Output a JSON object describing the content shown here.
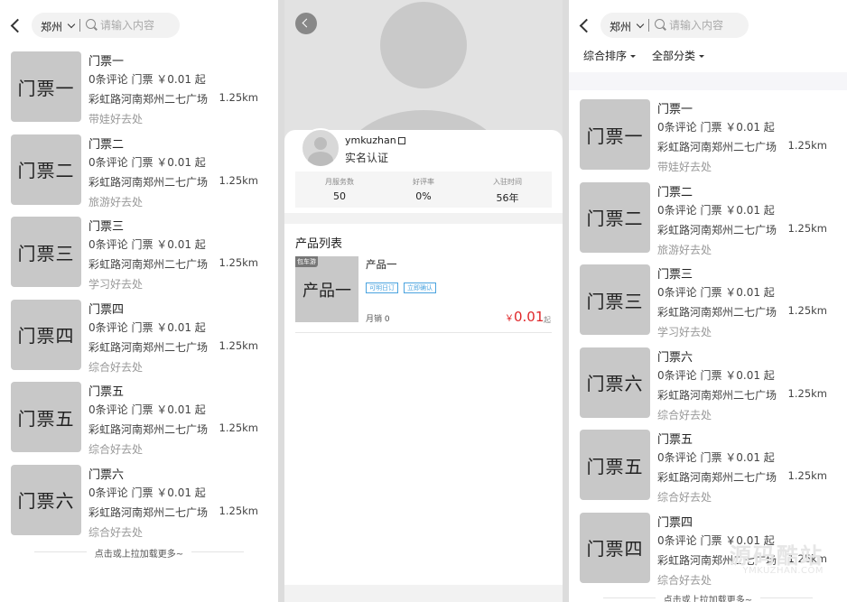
{
  "search": {
    "city": "郑州",
    "placeholder": "请输入内容"
  },
  "panel1": {
    "items": [
      {
        "thumb": "门票一",
        "name": "门票一",
        "meta": "0条评论  门票  ￥0.01  起",
        "addr": "彩虹路河南郑州二七广场",
        "dist": "1.25km",
        "tag": "带娃好去处"
      },
      {
        "thumb": "门票二",
        "name": "门票二",
        "meta": "0条评论  门票  ￥0.01  起",
        "addr": "彩虹路河南郑州二七广场",
        "dist": "1.25km",
        "tag": "旅游好去处"
      },
      {
        "thumb": "门票三",
        "name": "门票三",
        "meta": "0条评论  门票  ￥0.01  起",
        "addr": "彩虹路河南郑州二七广场",
        "dist": "1.25km",
        "tag": "学习好去处"
      },
      {
        "thumb": "门票四",
        "name": "门票四",
        "meta": "0条评论  门票  ￥0.01  起",
        "addr": "彩虹路河南郑州二七广场",
        "dist": "1.25km",
        "tag": "综合好去处"
      },
      {
        "thumb": "门票五",
        "name": "门票五",
        "meta": "0条评论  门票  ￥0.01  起",
        "addr": "彩虹路河南郑州二七广场",
        "dist": "1.25km",
        "tag": "综合好去处"
      },
      {
        "thumb": "门票六",
        "name": "门票六",
        "meta": "0条评论  门票  ￥0.01  起",
        "addr": "彩虹路河南郑州二七广场",
        "dist": "1.25km",
        "tag": "综合好去处"
      }
    ],
    "load_more": "点击或上拉加载更多~"
  },
  "panel2": {
    "username": "ymkuzhan",
    "verify": "实名认证",
    "stats": [
      {
        "label": "月服务数",
        "value": "50"
      },
      {
        "label": "好评率",
        "value": "0%"
      },
      {
        "label": "入驻时间",
        "value": "56年"
      }
    ],
    "section_title": "产品列表",
    "product": {
      "badge": "包车游",
      "thumb": "产品一",
      "name": "产品一",
      "chips": [
        "可明日订",
        "立即确认"
      ],
      "sales": "月销 0",
      "price_currency": "￥",
      "price": "0.01",
      "unit": "起"
    }
  },
  "panel3": {
    "filters": [
      "综合排序",
      "全部分类"
    ],
    "items": [
      {
        "thumb": "门票一",
        "name": "门票一",
        "meta": "0条评论  门票  ￥0.01  起",
        "addr": "彩虹路河南郑州二七广场",
        "dist": "1.25km",
        "tag": "带娃好去处"
      },
      {
        "thumb": "门票二",
        "name": "门票二",
        "meta": "0条评论  门票  ￥0.01  起",
        "addr": "彩虹路河南郑州二七广场",
        "dist": "1.25km",
        "tag": "旅游好去处"
      },
      {
        "thumb": "门票三",
        "name": "门票三",
        "meta": "0条评论  门票  ￥0.01  起",
        "addr": "彩虹路河南郑州二七广场",
        "dist": "1.25km",
        "tag": "学习好去处"
      },
      {
        "thumb": "门票六",
        "name": "门票六",
        "meta": "0条评论  门票  ￥0.01  起",
        "addr": "彩虹路河南郑州二七广场",
        "dist": "1.25km",
        "tag": "综合好去处"
      },
      {
        "thumb": "门票五",
        "name": "门票五",
        "meta": "0条评论  门票  ￥0.01  起",
        "addr": "彩虹路河南郑州二七广场",
        "dist": "1.25km",
        "tag": "综合好去处"
      },
      {
        "thumb": "门票四",
        "name": "门票四",
        "meta": "0条评论  门票  ￥0.01  起",
        "addr": "彩虹路河南郑州二七广场",
        "dist": "1.25km",
        "tag": "综合好去处"
      }
    ],
    "load_more": "点击或上拉加载更多~"
  },
  "watermark": {
    "text": "源码酷站",
    "url": "YMKUZHAN.COM"
  }
}
